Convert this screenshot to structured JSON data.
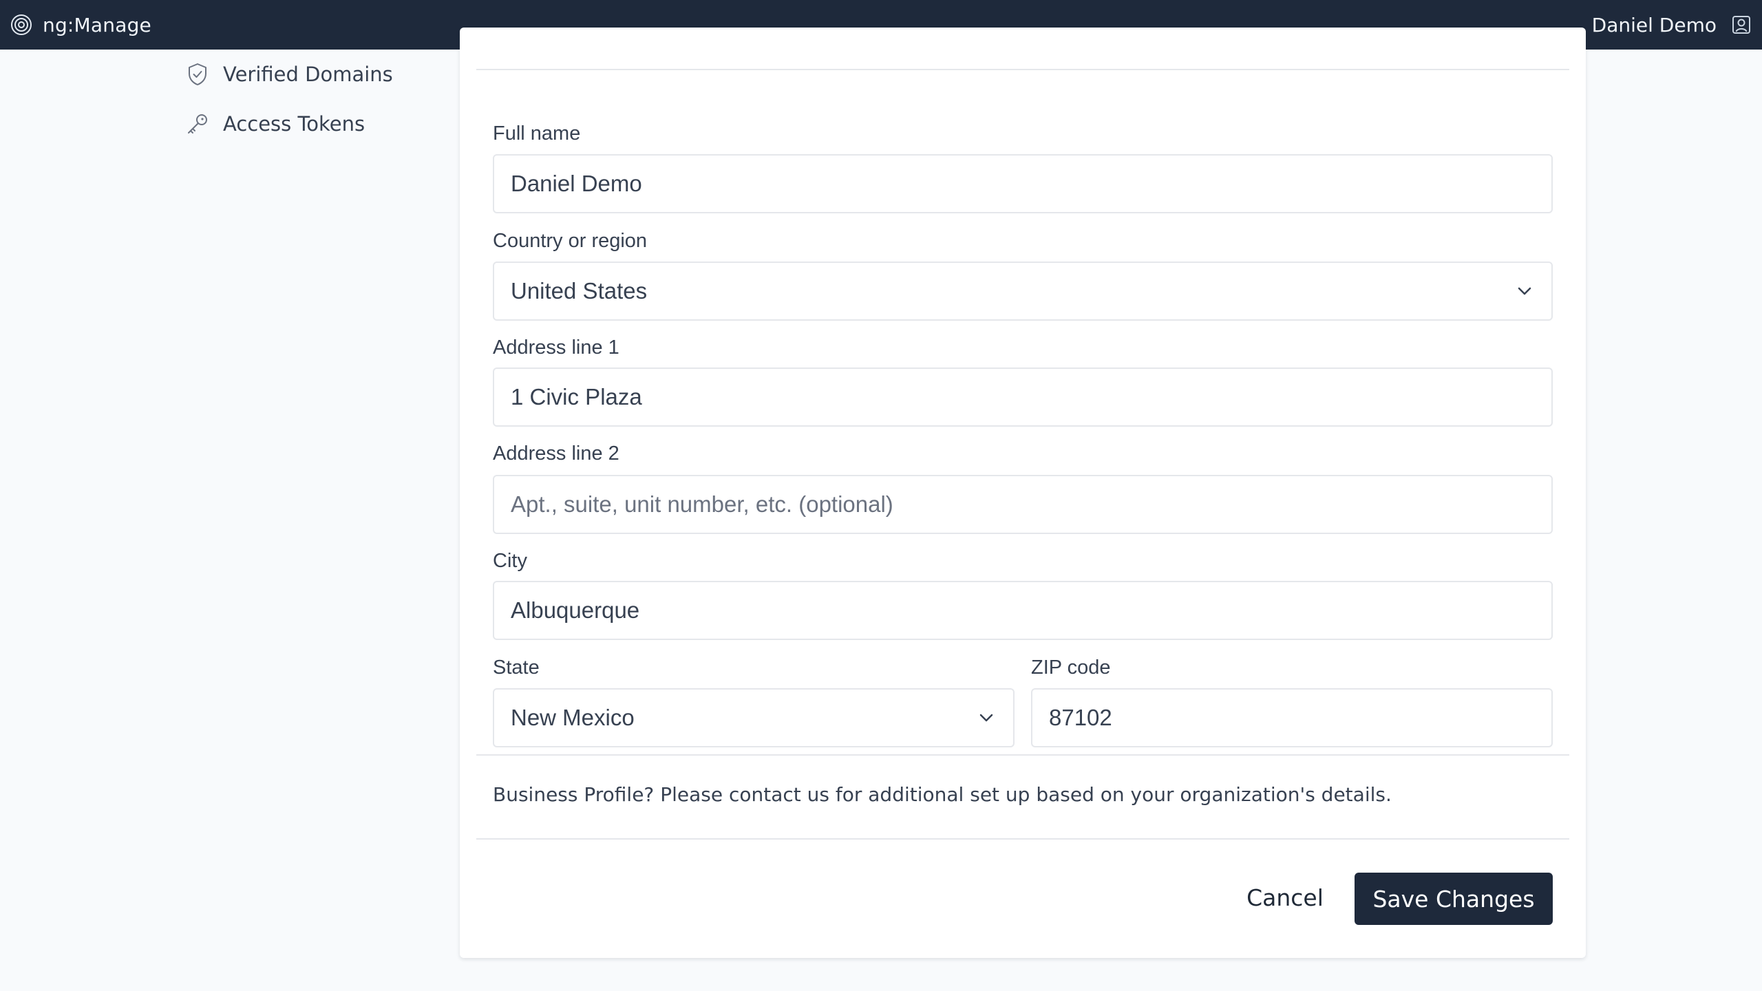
{
  "header": {
    "app_name": "ng:Manage",
    "user_name": "Daniel Demo"
  },
  "sidebar": {
    "items": [
      {
        "label": "Verified Domains",
        "icon": "shield-check-icon"
      },
      {
        "label": "Access Tokens",
        "icon": "key-icon"
      }
    ]
  },
  "form": {
    "full_name": {
      "label": "Full name",
      "value": "Daniel Demo"
    },
    "country": {
      "label": "Country or region",
      "value": "United States"
    },
    "address1": {
      "label": "Address line 1",
      "value": "1 Civic Plaza"
    },
    "address2": {
      "label": "Address line 2",
      "value": "",
      "placeholder": "Apt., suite, unit number, etc. (optional)"
    },
    "city": {
      "label": "City",
      "value": "Albuquerque"
    },
    "state": {
      "label": "State",
      "value": "New Mexico"
    },
    "zip": {
      "label": "ZIP code",
      "value": "87102"
    }
  },
  "note": "Business Profile? Please contact us for additional set up based on your organization's details.",
  "actions": {
    "cancel_label": "Cancel",
    "save_label": "Save Changes"
  },
  "colors": {
    "header_bg": "#1e293b",
    "primary_button": "#1e293b"
  }
}
